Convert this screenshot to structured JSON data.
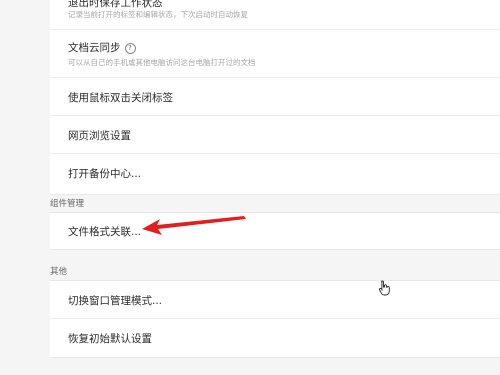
{
  "general": {
    "items": [
      {
        "title": "退出时保存工作状态",
        "description": "记录当前打开的标签和编辑状态，下次启动时自动恢复"
      },
      {
        "title": "文档云同步",
        "description": "可以从自己的手机或其他电脑访问这台电脑打开过的文档"
      },
      {
        "title": "使用鼠标双击关闭标签"
      },
      {
        "title": "网页浏览设置"
      },
      {
        "title": "打开备份中心..."
      }
    ]
  },
  "components": {
    "header": "组件管理",
    "items": [
      {
        "title": "文件格式关联..."
      }
    ]
  },
  "other": {
    "header": "其他",
    "items": [
      {
        "title": "切换窗口管理模式..."
      },
      {
        "title": "恢复初始默认设置"
      }
    ]
  },
  "annotation": {
    "arrow_color": "#e02020"
  }
}
